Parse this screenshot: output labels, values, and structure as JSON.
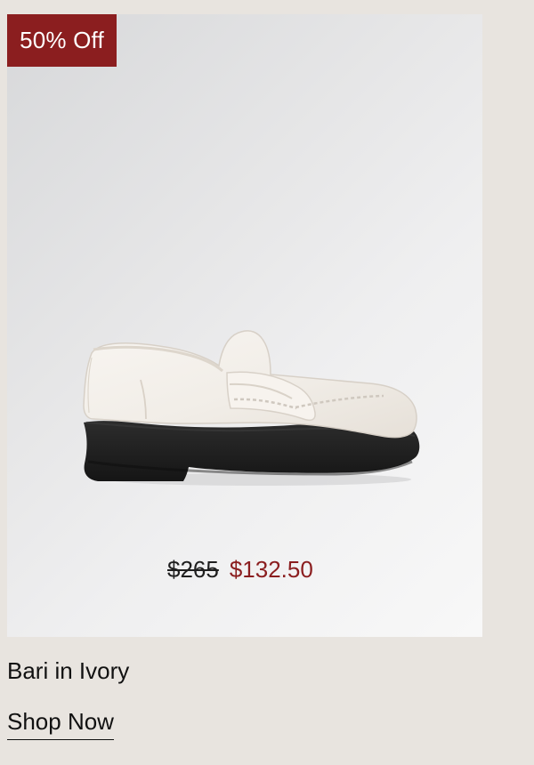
{
  "product": {
    "badge": "50% Off",
    "original_price": "$265",
    "sale_price": "$132.50",
    "name": "Bari in Ivory",
    "cta_label": "Shop Now"
  },
  "colors": {
    "badge_background": "#8b1e1f",
    "sale_price": "#8b1e1f",
    "page_background": "#e8e4df",
    "shoe_upper": "#f3efe9",
    "shoe_sole": "#232323"
  },
  "media": {
    "icon": "ivory-loafer-image"
  }
}
